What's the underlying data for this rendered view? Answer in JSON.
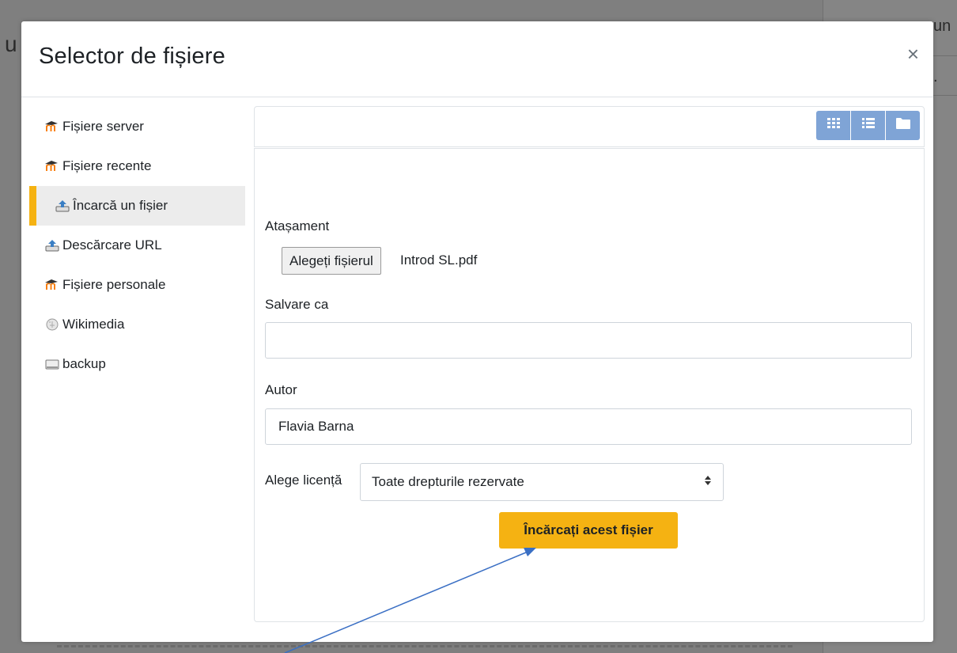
{
  "background": {
    "left_fragment": "u",
    "right_fragment": "un",
    "right_dot": "."
  },
  "modal": {
    "title": "Selector de fișiere",
    "close_glyph": "×"
  },
  "sidebar": {
    "items": [
      {
        "label": "Fișiere server",
        "icon": "moodle-icon",
        "active": false
      },
      {
        "label": "Fișiere recente",
        "icon": "moodle-icon",
        "active": false
      },
      {
        "label": "Încarcă un fișier",
        "icon": "upload-icon",
        "active": true
      },
      {
        "label": "Descărcare URL",
        "icon": "upload-icon",
        "active": false
      },
      {
        "label": "Fișiere personale",
        "icon": "moodle-icon",
        "active": false
      },
      {
        "label": "Wikimedia",
        "icon": "wikimedia-icon",
        "active": false
      },
      {
        "label": "backup",
        "icon": "drive-icon",
        "active": false
      }
    ]
  },
  "toolbar": {
    "views": [
      "grid-view-icon",
      "list-view-icon",
      "folder-view-icon"
    ]
  },
  "form": {
    "attachment_label": "Atașament",
    "choose_file_button": "Alegeți fișierul",
    "chosen_file": "Introd SL.pdf",
    "save_as_label": "Salvare ca",
    "save_as_value": "",
    "author_label": "Autor",
    "author_value": "Flavia Barna",
    "license_label": "Alege licență",
    "license_value": "Toate drepturile rezervate",
    "upload_button": "Încărcați acest fișier"
  },
  "colors": {
    "accent": "#f5b212",
    "view_buttons": "#7fa4d6",
    "annotation_arrow": "#3a6fc4"
  }
}
